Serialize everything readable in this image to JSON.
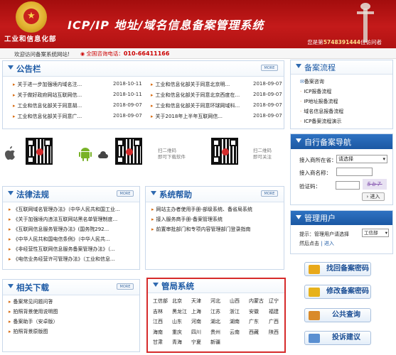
{
  "header": {
    "org_name": "工业和信息化部",
    "title": "ICP/IP 地址/域名信息备案管理系统",
    "visits_prefix": "您是第",
    "visits_count": "5748391444",
    "visits_suffix": "位访问者"
  },
  "infobar": {
    "welcome": "欢迎访问备案系统网站!",
    "hotline_label": "全国咨询电话：",
    "hotline_number": "010-66411166"
  },
  "notice": {
    "title": "公告栏",
    "more": "MORE",
    "items": [
      {
        "text": "关于进一步加强境内域名注...",
        "date": "2018-10-11"
      },
      {
        "text": "工业和信息化部关于同意北京明...",
        "date": "2018-09-07"
      },
      {
        "text": "关于做好政府网站互联网信...",
        "date": "2018-10-11"
      },
      {
        "text": "工业和信息化部关于同意北京西度在...",
        "date": "2018-09-07"
      },
      {
        "text": "工业和信息化部关于同意胡...",
        "date": "2018-09-07"
      },
      {
        "text": "工业和信息化部关于同意环球网域科...",
        "date": "2018-09-07"
      },
      {
        "text": "工业和信息化部关于同意广...",
        "date": "2018-09-07"
      },
      {
        "text": "关于2018年上半年互联网信...",
        "date": "2018-09-07"
      }
    ]
  },
  "downloads": {
    "scan_download": [
      "扫二维码",
      "即可下载软件"
    ],
    "scan_follow": [
      "扫二维码",
      "即可关注"
    ]
  },
  "laws": {
    "title": "法律法规",
    "more": "MORE",
    "items": [
      "《互联网域名管理办法》（中华人民共和国工业...",
      "《关于加强境内违法互联网站黑名单管理制度...",
      "《互联网信息服务管理办法》(国务院292...",
      "《中华人民共和国电信条例》（中华人民共...",
      "《非经营性互联网信息服务备案管理办法》（...",
      "《电信业务经营许可管理办法》（工业和信息..."
    ]
  },
  "help": {
    "title": "系统帮助",
    "more": "MORE",
    "items": [
      "网站主办者使用手册-部级系统、备省局系统",
      "接入服务商手册-备案管理系统",
      "前置审批部门和专项内容管理部门登录指南"
    ]
  },
  "related": {
    "title": "相关下载",
    "more": "MORE",
    "items": [
      "备案常见问题问答",
      "拍照背景使用说明图",
      "备案助手（安卓版）",
      "拍照背景原版图"
    ]
  },
  "bureaus": {
    "title": "管局系统",
    "cities": [
      [
        "工信部",
        "北京",
        "天津",
        "河北",
        "山西",
        "内蒙古",
        "辽宁"
      ],
      [
        "吉林",
        "黑龙江",
        "上海",
        "江苏",
        "浙江",
        "安徽",
        "福建"
      ],
      [
        "江西",
        "山东",
        "河南",
        "湖北",
        "湖南",
        "广东",
        "广西"
      ],
      [
        "海南",
        "重庆",
        "四川",
        "贵州",
        "云南",
        "西藏",
        "陕西"
      ],
      [
        "甘肃",
        "青海",
        "宁夏",
        "新疆"
      ]
    ]
  },
  "process": {
    "title": "备案流程",
    "items": [
      "备案咨询",
      "ICP报备流程",
      "IP地址报备流程",
      "域名信息报备流程",
      "ICP备案流程演示"
    ]
  },
  "nav": {
    "title": "自行备案导航",
    "province_label": "接入商所在省：",
    "province_value": "请选择",
    "isp_label": "接入商名称：",
    "captcha_label": "验证码：",
    "captcha_text": "5b7",
    "enter_label": "进入"
  },
  "admin": {
    "title": "管理用户",
    "hint_prefix": "提示：管理用户请选择",
    "hint_value": "工信部",
    "hint_suffix": "然后点击",
    "enter_label": "进入"
  },
  "actions": [
    {
      "label": "找回备案密码",
      "icon": "key-icon",
      "color": "#e8a91b"
    },
    {
      "label": "修改备案密码",
      "icon": "lock-icon",
      "color": "#e7b21c"
    },
    {
      "label": "公共查询",
      "icon": "magnifier-icon",
      "color": "#d98a2a"
    },
    {
      "label": "投诉建议",
      "icon": "speech-icon",
      "color": "#5a8fd1"
    }
  ]
}
